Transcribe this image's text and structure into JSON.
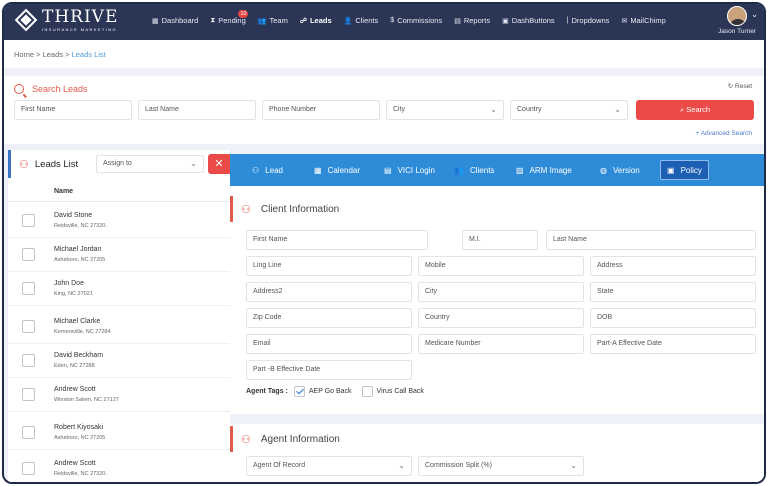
{
  "nav": {
    "brand": "THRIVE",
    "brand_sub": "INSURANCE MARKETING",
    "items": [
      {
        "icon": "▦",
        "label": "Dashboard"
      },
      {
        "icon": "⧗",
        "label": "Pending",
        "badge": "10"
      },
      {
        "icon": "👥",
        "label": "Team"
      },
      {
        "icon": "☍",
        "label": "Leads"
      },
      {
        "icon": "👤",
        "label": "Clients"
      },
      {
        "icon": "$",
        "label": "Commissions"
      },
      {
        "icon": "▤",
        "label": "Reports"
      },
      {
        "icon": "▣",
        "label": "DashButtons"
      },
      {
        "icon": "|",
        "label": "Dropdowns"
      },
      {
        "icon": "✉",
        "label": "MailChimp"
      }
    ],
    "active": "Leads",
    "user_name": "Jason Turner",
    "user_caret": "⌄"
  },
  "breadcrumb": {
    "home": "Home",
    "sep": " > ",
    "leads": "Leads",
    "current": "Leads List"
  },
  "search": {
    "title": "Search Leads",
    "reset": "Reset",
    "reset_icon": "↻",
    "first_name": "First Name",
    "last_name": "Last Name",
    "phone": "Phone Number",
    "city": "City",
    "country": "Country",
    "button": "Search",
    "button_icon": "⌕",
    "advanced": "Advanced Search",
    "advanced_icon": "+"
  },
  "leads": {
    "title": "Leads List",
    "assign": "Assign to",
    "close": "✕",
    "column": "Name",
    "rows": [
      {
        "name": "David Stone",
        "address": "Reidsville, NC 27320."
      },
      {
        "name": "Michael Jordan",
        "address": "Asheboro, NC 27205"
      },
      {
        "name": "John Doe",
        "address": "King, NC 27021"
      },
      {
        "name": "Michael Clarke",
        "address": "Kernersville, NC 27284"
      },
      {
        "name": "David Beckham",
        "address": "Eden, NC 27288"
      },
      {
        "name": "Andrew Scott",
        "address": "Winston Salem, NC 27127"
      },
      {
        "name": "Robert Kiyosaki",
        "address": "Asheboro, NC 27205"
      },
      {
        "name": "Andrew Scott",
        "address": "Reidsville, NC 27320."
      }
    ]
  },
  "tabs": [
    {
      "icon": "⚇",
      "label": "Lead"
    },
    {
      "icon": "▦",
      "label": "Calendar"
    },
    {
      "icon": "▤",
      "label": "VICI Login"
    },
    {
      "icon": "👥",
      "label": "Clients"
    },
    {
      "icon": "▨",
      "label": "ARM Image"
    },
    {
      "icon": "◍",
      "label": "Version"
    },
    {
      "icon": "▣",
      "label": "Policy"
    }
  ],
  "active_tab": "Policy",
  "client": {
    "title": "Client Information",
    "icon": "⚇",
    "first_name": "First Name",
    "mi": "M.I.",
    "last_name": "Last Name",
    "ling_line": "Ling Line",
    "mobile": "Mobile",
    "address": "Address",
    "address2": "Address2",
    "city": "City",
    "state": "State",
    "zip": "Zip Code",
    "country": "Country",
    "dob": "DOB",
    "email": "Email",
    "medicare": "Medicare Number",
    "part_a": "Part-A Effective Date",
    "part_b": "Part -B Effective Date",
    "tags_label": "Agent Tags :",
    "tag1": "AEP Go Back",
    "tag1_checked": true,
    "tag2": "Virus Call Back",
    "tag2_checked": false
  },
  "agent": {
    "title": "Agent Information",
    "icon": "⚇",
    "agent_of_record": "Agent Of Record",
    "commission_split": "Commission Split (%)"
  },
  "colors": {
    "nav_bg": "#2b3556",
    "accent_red": "#ea4a48",
    "tab_bar": "#2e8bd8",
    "active_tab": "#1d5fb3",
    "link_blue": "#4b9bd8"
  }
}
